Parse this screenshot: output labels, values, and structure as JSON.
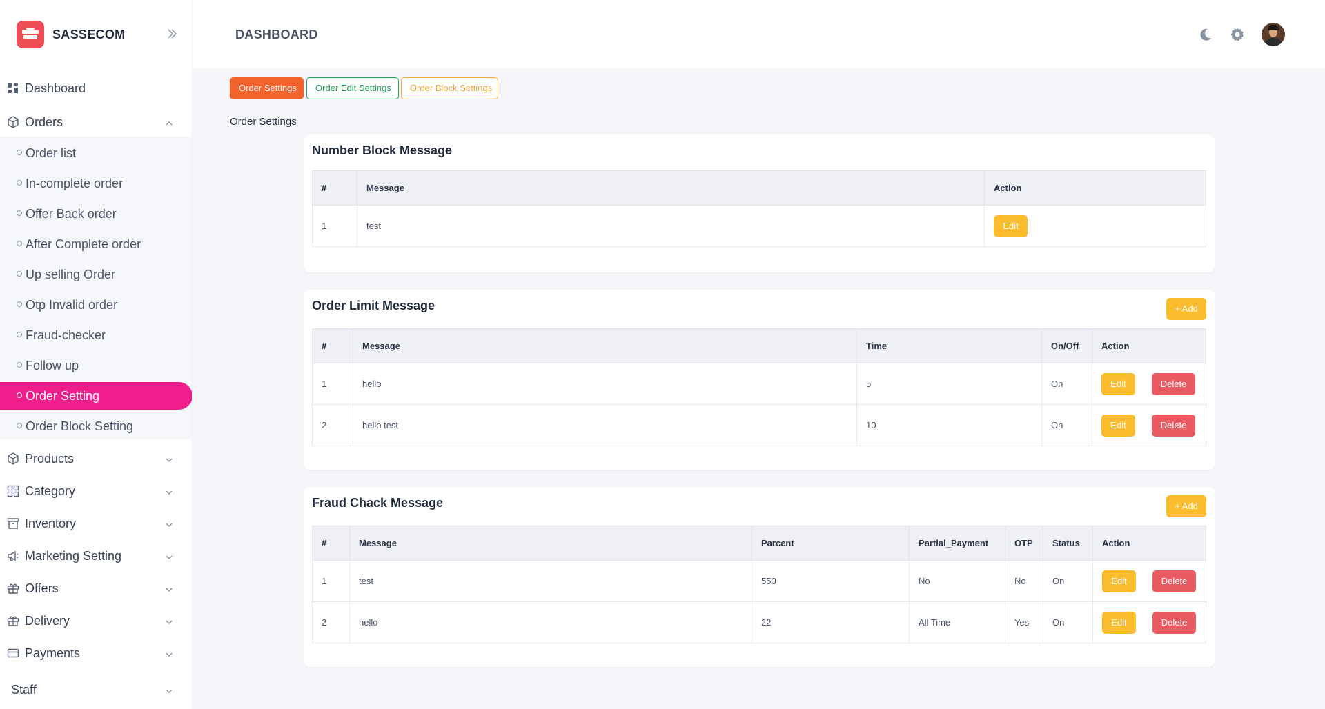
{
  "brand": {
    "name": "SASSECOM"
  },
  "header": {
    "title": "DASHBOARD"
  },
  "sidebar": {
    "dashboard": "Dashboard",
    "orders": "Orders",
    "order_sub": [
      "Order list",
      "In-complete order",
      "Offer Back order",
      "After Complete order",
      "Up selling Order",
      "Otp Invalid order",
      "Fraud-checker",
      "Follow up",
      "Order Setting",
      "Order Block Setting"
    ],
    "products": "Products",
    "category": "Category",
    "inventory": "Inventory",
    "marketing": "Marketing Setting",
    "offers": "Offers",
    "delivery": "Delivery",
    "payments": "Payments",
    "staff": "Staff"
  },
  "tabs": [
    "Order Settings",
    "Order Edit Settings",
    "Order Block Settings"
  ],
  "section_label": "Order Settings",
  "number_block": {
    "title": "Number Block Message",
    "headers": [
      "#",
      "Message",
      "Action"
    ],
    "rows": [
      {
        "no": "1",
        "message": "test"
      }
    ]
  },
  "order_limit": {
    "title": "Order Limit Message",
    "add_label": "+ Add",
    "headers": [
      "#",
      "Message",
      "Time",
      "On/Off",
      "Action"
    ],
    "rows": [
      {
        "no": "1",
        "message": "hello",
        "time": "5",
        "onoff": "On"
      },
      {
        "no": "2",
        "message": "hello test",
        "time": "10",
        "onoff": "On"
      }
    ]
  },
  "fraud_check": {
    "title": "Fraud Chack Message",
    "add_label": "+ Add",
    "headers": [
      "#",
      "Message",
      "Parcent",
      "Partial_Payment",
      "OTP",
      "Status",
      "Action"
    ],
    "rows": [
      {
        "no": "1",
        "message": "test",
        "parcent": "550",
        "partial": "No",
        "otp": "No",
        "status": "On"
      },
      {
        "no": "2",
        "message": "hello",
        "parcent": "22",
        "partial": "All Time",
        "otp": "Yes",
        "status": "On"
      }
    ]
  },
  "actions": {
    "edit": "Edit",
    "delete": "Delete"
  },
  "colors": {
    "accent_pink": "#f01e8c",
    "orange": "#f4622b",
    "green": "#22a35a",
    "yellow": "#fbbd2e",
    "red": "#ea5a63"
  }
}
